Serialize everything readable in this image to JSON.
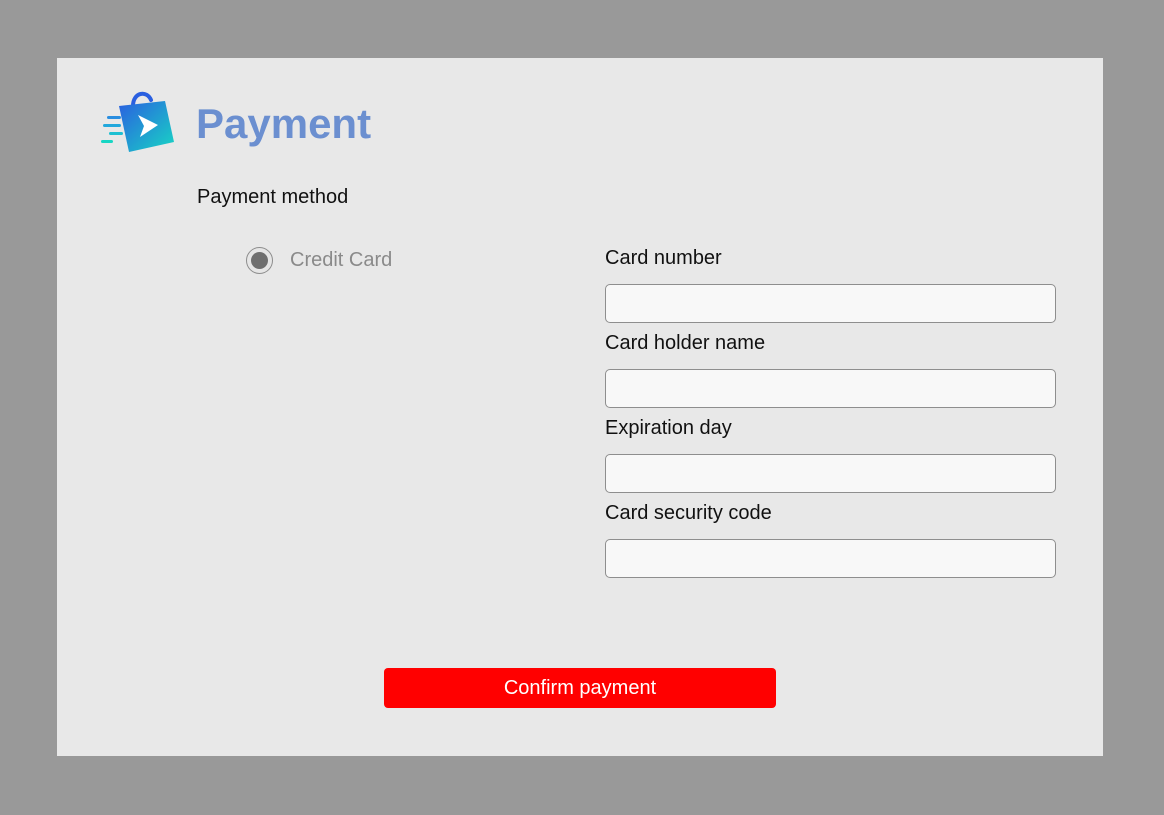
{
  "header": {
    "title": "Payment",
    "logo_icon": "shopping-bag-arrow-logo"
  },
  "payment_method": {
    "label": "Payment method",
    "options": [
      {
        "label": "Credit Card",
        "selected": true
      }
    ]
  },
  "form": {
    "fields": [
      {
        "label": "Card number",
        "value": ""
      },
      {
        "label": "Card holder name",
        "value": ""
      },
      {
        "label": "Expiration day",
        "value": ""
      },
      {
        "label": "Card security code",
        "value": ""
      }
    ]
  },
  "actions": {
    "confirm_label": "Confirm payment"
  },
  "colors": {
    "backdrop": "#999999",
    "panel": "#e8e8e8",
    "title": "#6b8fd0",
    "confirm_button": "#ff0000",
    "logo_gradient_start": "#2a5fe0",
    "logo_gradient_end": "#18d6c4"
  }
}
